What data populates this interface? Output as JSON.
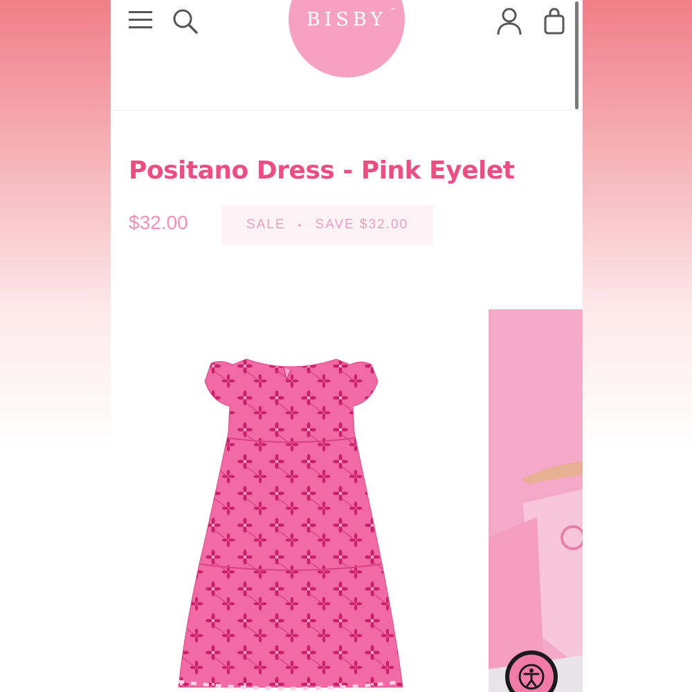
{
  "header": {
    "logo_text": "BISBY",
    "logo_tm": "™",
    "icons": [
      "menu-icon",
      "search-icon",
      "account-icon",
      "shopping-bag-icon"
    ]
  },
  "product": {
    "title": "Positano Dress - Pink Eyelet",
    "price": "$32.00",
    "sale_label": "SALE",
    "separator": "•",
    "save_text": "SAVE $32.00"
  },
  "colors": {
    "brand_pink": "#ee4d84",
    "logo_bg": "#f6a1c1",
    "price_pink": "#f28fb6",
    "badge_bg": "#fdf3f6"
  }
}
